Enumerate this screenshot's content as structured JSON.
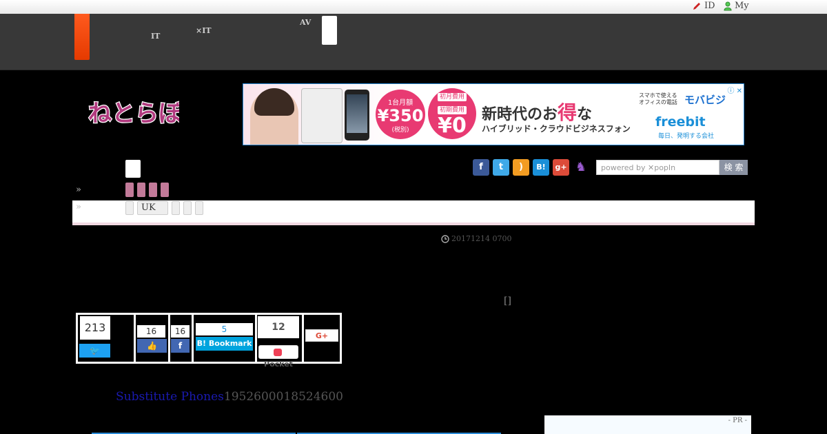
{
  "topbar": {
    "id_label": "ID",
    "my_label": "My"
  },
  "header": {
    "nav": [
      {
        "line1": "　　",
        "line2": "IT"
      },
      {
        "line1": "　　　",
        "line2": "×IT"
      },
      {
        "line1": "AV",
        "line2": "　　"
      }
    ]
  },
  "logo": {
    "text": "ねとらぼ"
  },
  "ad": {
    "monthly_label": "1台月額",
    "monthly_price": "¥350",
    "tax": "(税別)",
    "initial_tag1": "初月費用",
    "initial_tag2": "初期費用",
    "initial_price": "¥0",
    "headline_a": "新時代のお",
    "headline_em": "得",
    "headline_b": "な",
    "subline": "ハイブリッド・クラウドビジネスフォン",
    "right_small": "スマホで使える\nオフィスの電話",
    "right_brand": "モバビジ",
    "freebit": "freebit",
    "tagline": "毎日、発明する会社"
  },
  "social_icons": [
    "facebook-icon",
    "twitter-icon",
    "rss-icon",
    "hatena-icon",
    "googleplus-icon",
    "cat-icon"
  ],
  "search": {
    "placeholder": "powered by ✕popIn",
    "button": "検 索"
  },
  "breadcrumb": {
    "sep": "»",
    "tag_uk": "UK"
  },
  "article": {
    "date": "20171214 0700",
    "bracket": "[]",
    "link_text": "Substitute Phones",
    "trailing": "1952600018524600"
  },
  "share": {
    "tweet_count": "213",
    "like_count": "16",
    "fb_count": "16",
    "hatena_count": "5",
    "hatena_label": "B! Bookmark",
    "pocket_count": "12",
    "pocket_label": "Pocket",
    "gplus_label": "G+"
  },
  "pr": {
    "label": "- PR -"
  },
  "colors": {
    "header": "#383838",
    "orange": "#ff5a1e",
    "pink": "#c27a99",
    "link": "#1a1ab0"
  }
}
